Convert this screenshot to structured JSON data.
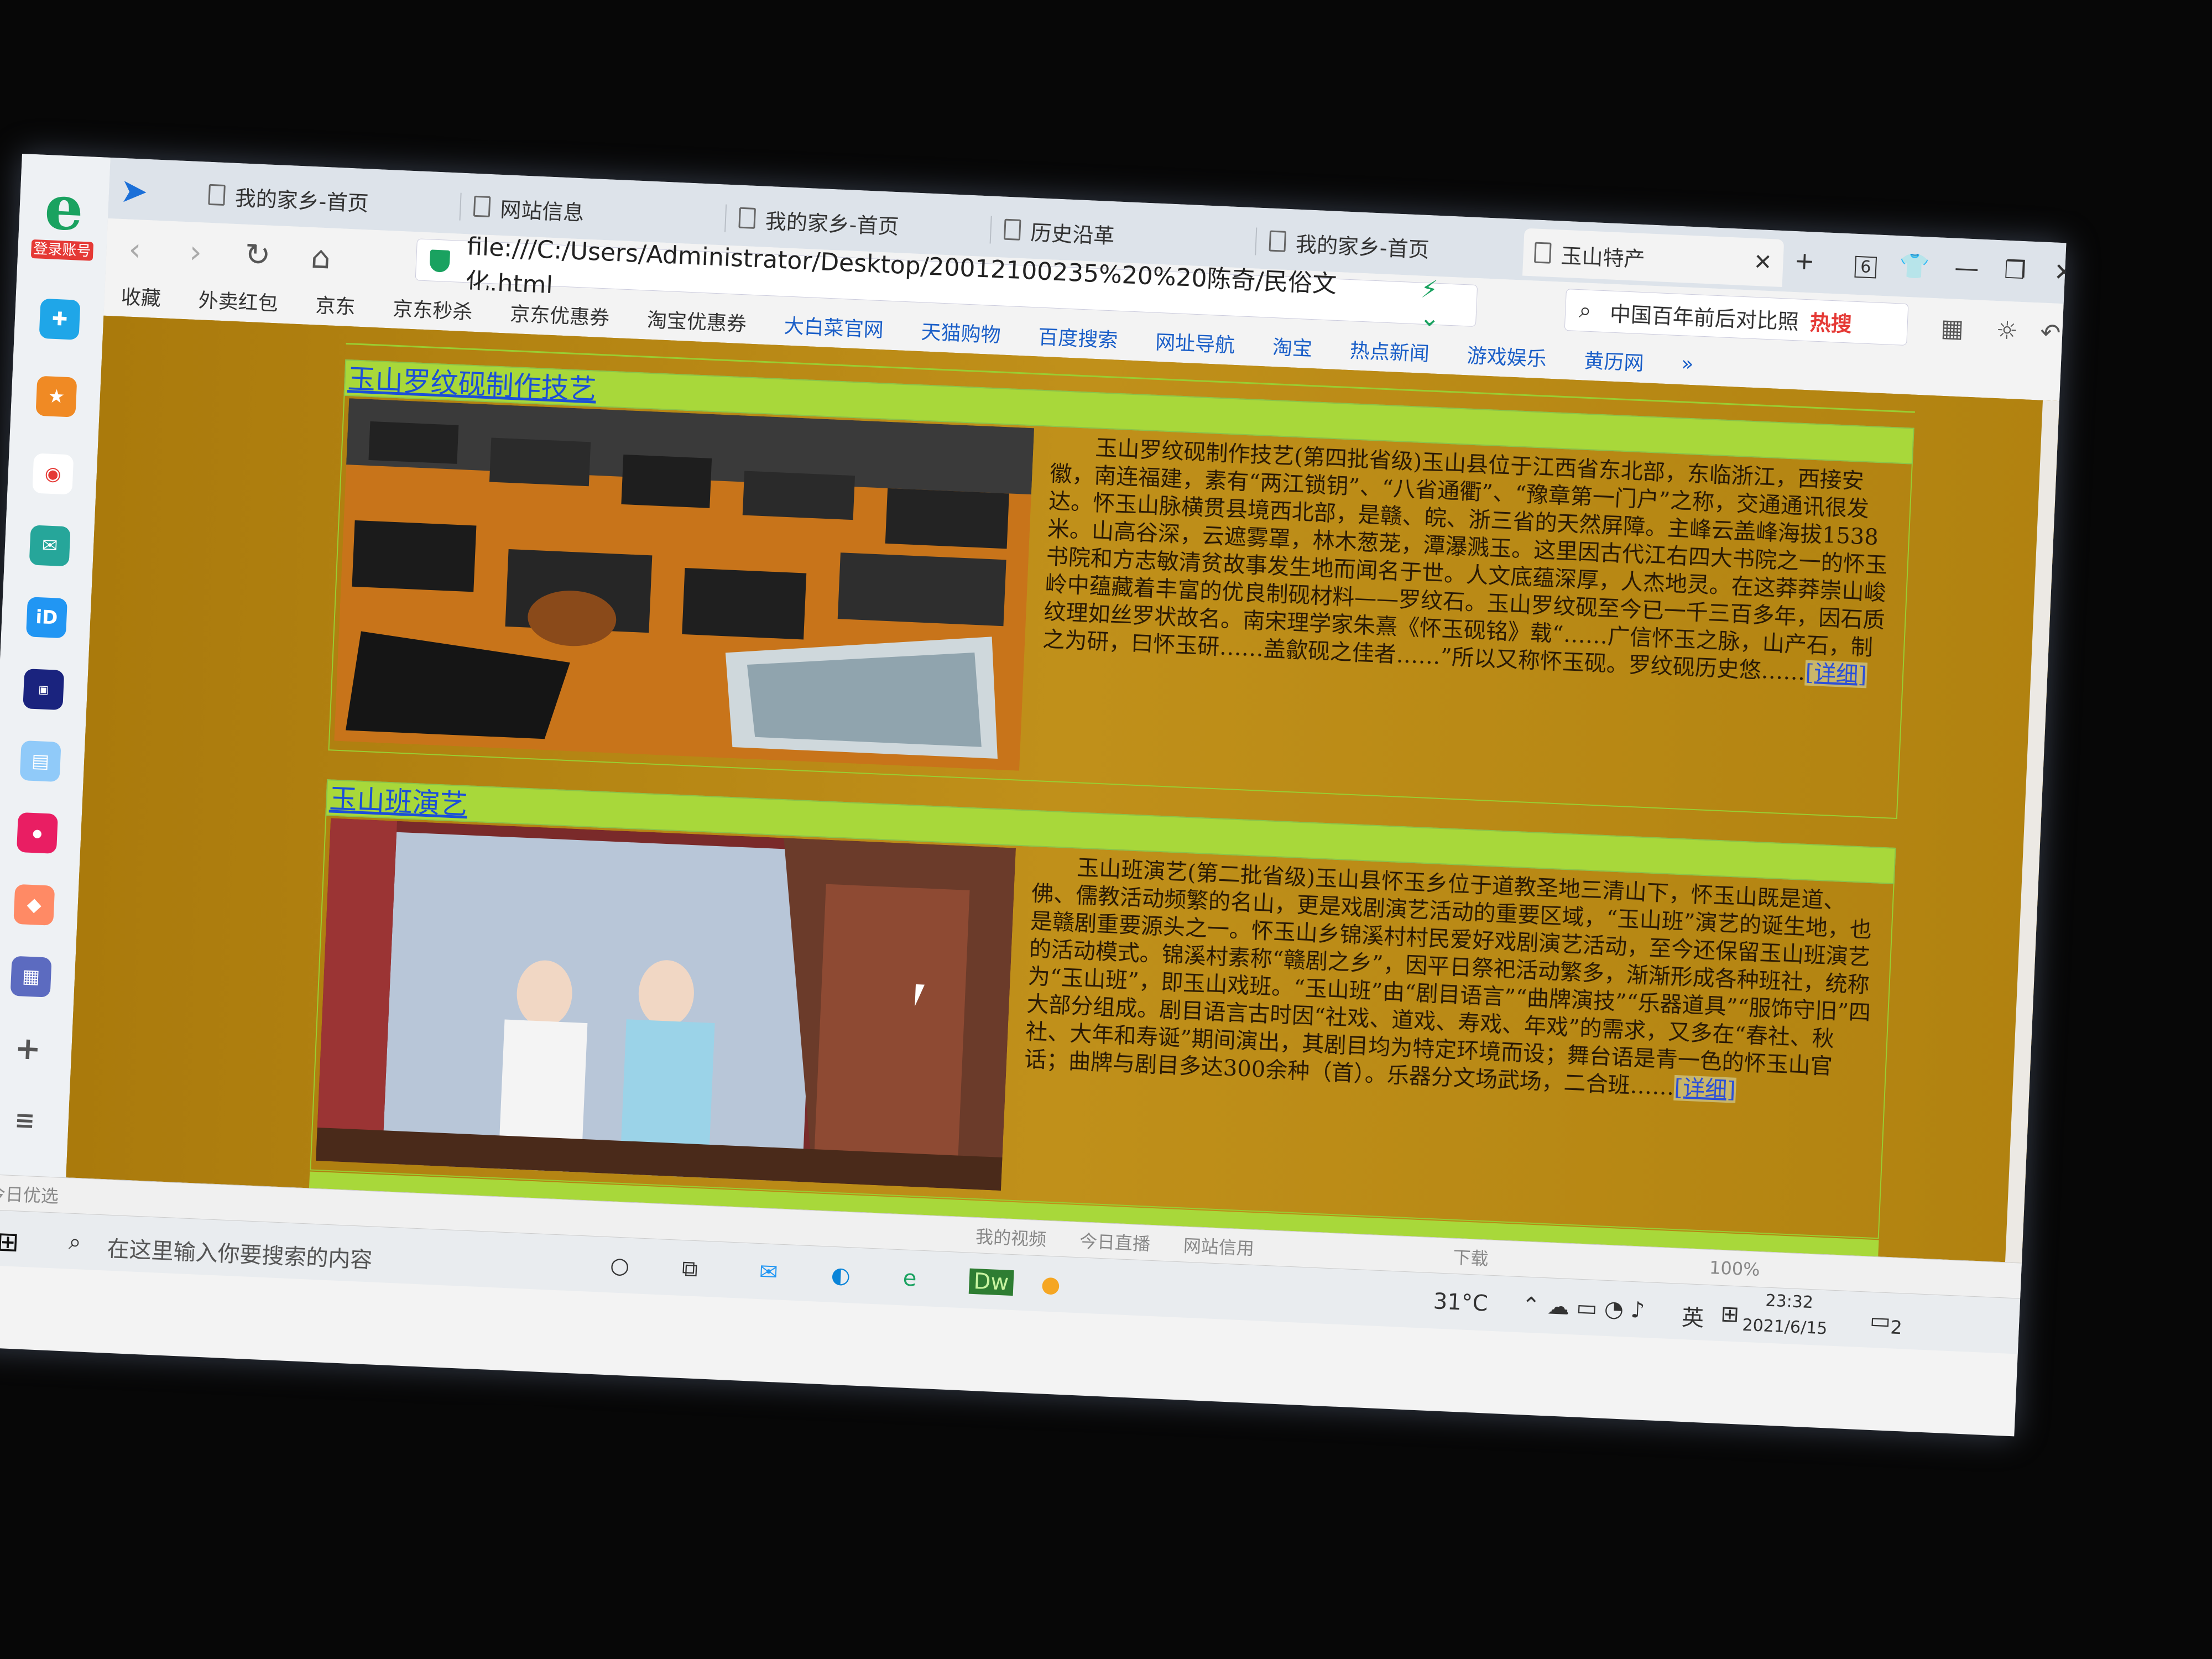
{
  "sidebar": {
    "logo_label": "登录账号"
  },
  "tabs": [
    {
      "label": "我的家乡-首页"
    },
    {
      "label": "网站信息"
    },
    {
      "label": "我的家乡-首页"
    },
    {
      "label": "历史沿革"
    },
    {
      "label": "我的家乡-首页"
    },
    {
      "label": "玉山特产",
      "active": true
    }
  ],
  "window_controls": {
    "new_tab": "+",
    "tab_count": "6"
  },
  "address": {
    "url": "file:///C:/Users/Administrator/Desktop/20012100235%20%20陈奇/民俗文化.html"
  },
  "search": {
    "placeholder": "中国百年前后对比照",
    "hot": "热搜"
  },
  "bookmarks": [
    "收藏",
    "外卖红包",
    "京东",
    "京东秒杀",
    "京东优惠券",
    "淘宝优惠券",
    "大白菜官网",
    "天猫购物",
    "百度搜索",
    "网址导航",
    "淘宝",
    "热点新闻",
    "游戏娱乐",
    "黄历网",
    "»"
  ],
  "sections": [
    {
      "title": "玉山罗纹砚制作技艺",
      "text": "玉山罗纹砚制作技艺(第四批省级)玉山县位于江西省东北部，东临浙江，西接安徽，南连福建，素有“两江锁钥”、“八省通衢”、“豫章第一门户”之称，交通通讯很发达。怀玉山脉横贯县境西北部，是赣、皖、浙三省的天然屏障。主峰云盖峰海拔1538米。山高谷深，云遮雾罩，林木葱茏，潭瀑溅玉。这里因古代江右四大书院之一的怀玉书院和方志敏清贫故事发生地而闻名于世。人文底蕴深厚，人杰地灵。在这莽莽崇山峻岭中蕴藏着丰富的优良制砚材料——罗纹石。玉山罗纹砚至今已一千三百多年，因石质纹理如丝罗状故名。南宋理学家朱熹《怀玉砚铭》载“……广信怀玉之脉，山产石，制之为研，曰怀玉研……盖歙砚之佳者……”所以又称怀玉砚。罗纹砚历史悠……",
      "more": "[详细]"
    },
    {
      "title": "玉山班演艺",
      "text": "玉山班演艺(第二批省级)玉山县怀玉乡位于道教圣地三清山下，怀玉山既是道、佛、儒教活动频繁的名山，更是戏剧演艺活动的重要区域，“玉山班”演艺的诞生地，也是赣剧重要源头之一。怀玉山乡锦溪村村民爱好戏剧演艺活动，至今还保留玉山班演艺的活动模式。锦溪村素称“赣剧之乡”，因平日祭祀活动繁多，渐渐形成各种班社，统称为“玉山班”，即玉山戏班。“玉山班”由“剧目语言”“曲牌演技”“乐器道具”“服饰守旧”四大部分组成。剧目语言古时因“社戏、道戏、寿戏、年戏”的需求，又多在“春社、秋社、大年和寿诞”期间演出，其剧目均为特定环境而设；舞台语是青一色的怀玉山官话；曲牌与剧目多达300余种（首）。乐器分文场武场，二合班……",
      "more": "[详细]"
    }
  ],
  "statusbar": {
    "left": "今日优选",
    "items": [
      "我的视频",
      "今日直播",
      "网站信用",
      "下载",
      "100%"
    ]
  },
  "taskbar": {
    "search_placeholder": "在这里输入你要搜索的内容",
    "weather": "31°C",
    "ime": "英",
    "time": "23:32",
    "date": "2021/6/15",
    "notify_count": "2"
  }
}
